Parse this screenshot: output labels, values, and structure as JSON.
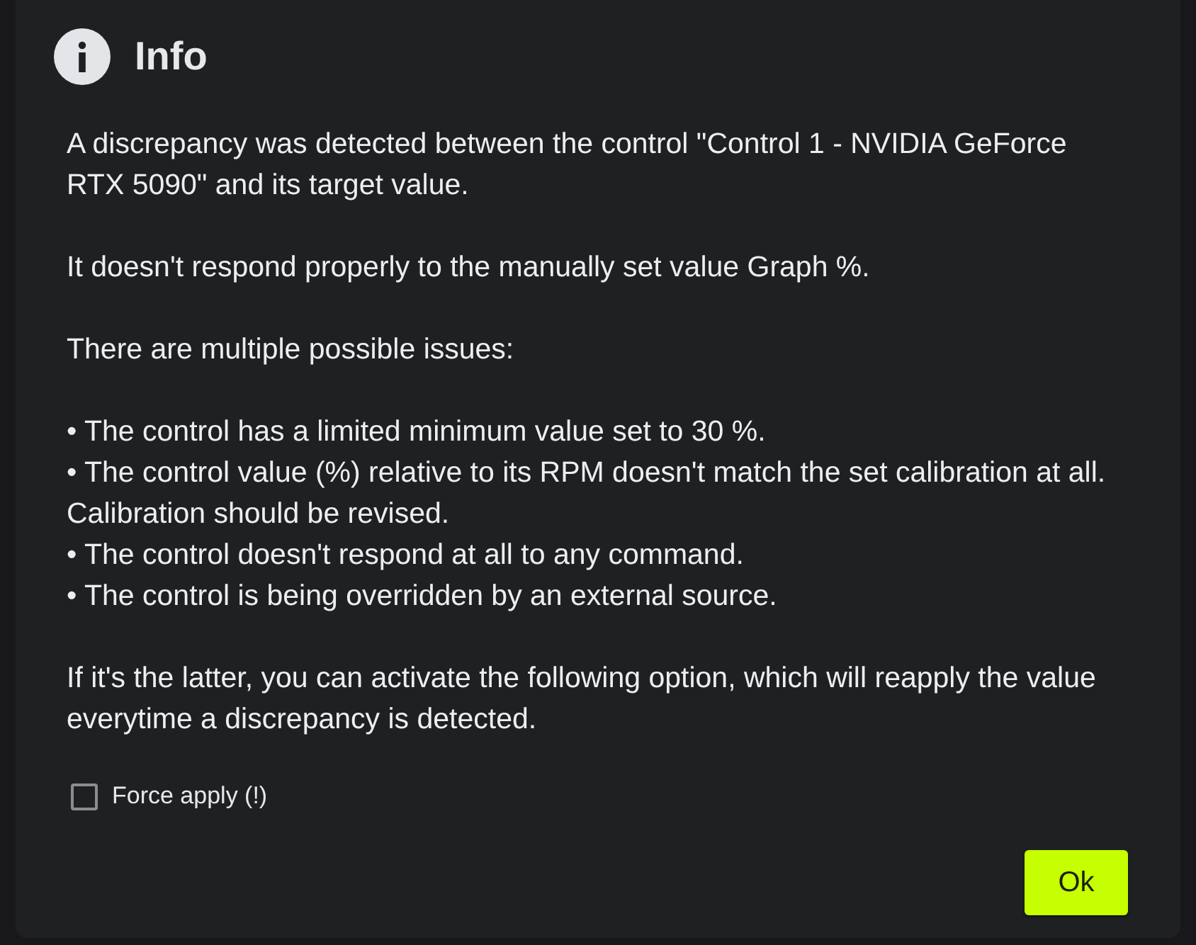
{
  "dialog": {
    "title": "Info",
    "message": [
      {
        "kind": "paragraph",
        "text": "A discrepancy was detected between the control \"Control 1 - NVIDIA GeForce RTX 5090\" and its target value."
      },
      {
        "kind": "paragraph",
        "text": "It doesn't respond properly to the manually set value Graph %."
      },
      {
        "kind": "paragraph",
        "text": "There are multiple possible issues:"
      },
      {
        "kind": "bullets",
        "items": [
          "• The control has a limited minimum value set to 30 %.",
          "• The control value (%) relative to its RPM doesn't match the set calibration at all. Calibration should be revised.",
          "• The control doesn't respond at all to any command.",
          "• The control is being overridden by an external source."
        ]
      },
      {
        "kind": "paragraph",
        "text": "If it's the latter, you can activate the following option, which will reapply the value everytime a discrepancy is detected."
      }
    ],
    "checkbox": {
      "label": "Force apply (!)",
      "checked": false
    },
    "buttons": [
      {
        "label": "Ok"
      }
    ]
  }
}
